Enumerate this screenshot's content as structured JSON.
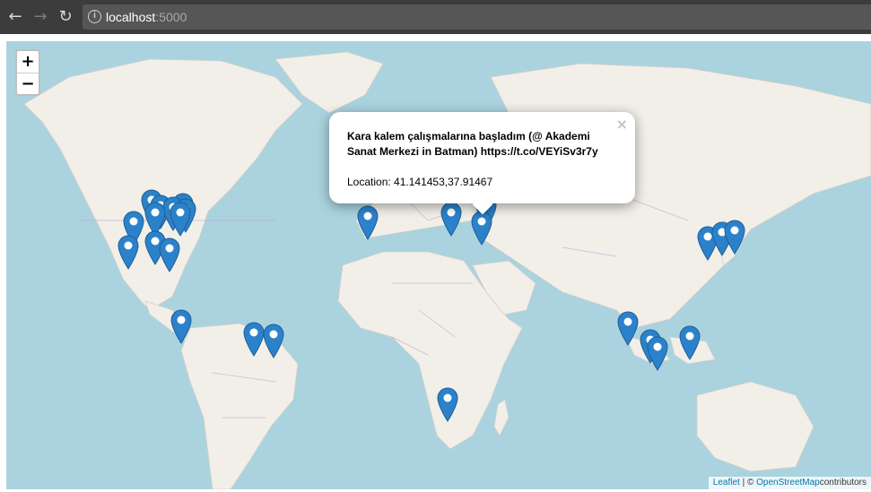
{
  "browser": {
    "url_host": "localhost",
    "url_port": ":5000",
    "back_icon": "arrow-left",
    "forward_icon": "arrow-right",
    "reload_icon": "reload",
    "info_icon": "info-circle"
  },
  "map": {
    "zoom_in_label": "+",
    "zoom_out_label": "−",
    "popup": {
      "message": "Kara kalem çalışmalarına başladım (@ Akademi Sanat Merkezi in Batman) https://t.co/VEYiSv3r7y",
      "location": "Location: 41.141453,37.91467",
      "close_label": "×"
    },
    "attribution": {
      "leaflet": "Leaflet",
      "separator": " | © ",
      "osm": "OpenStreetMap",
      "suffix": "contributors"
    },
    "colors": {
      "water": "#aad3df",
      "land": "#f2efe9",
      "marker": "#2b82cb",
      "borders": "#c9a3c9"
    }
  }
}
